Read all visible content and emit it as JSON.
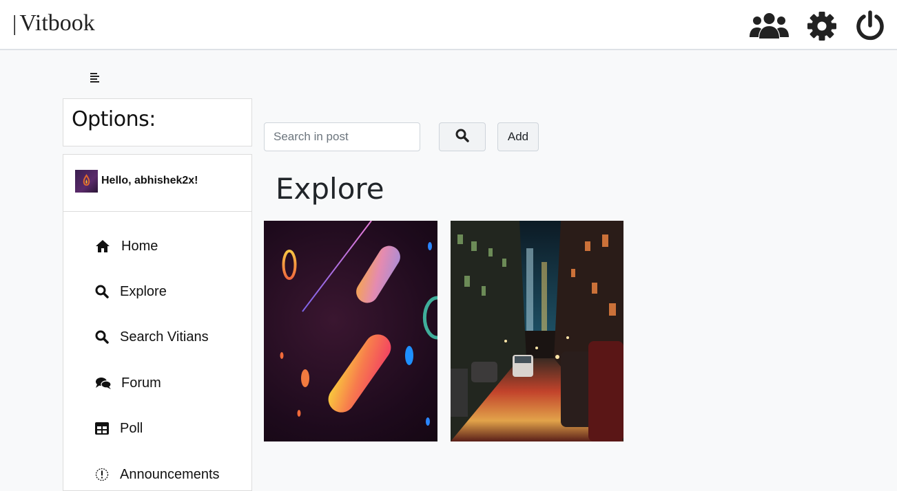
{
  "header": {
    "brand_bar": "|",
    "brand": "Vitbook",
    "icons": [
      "users-icon",
      "gear-icon",
      "power-icon"
    ]
  },
  "sidebar": {
    "options_title": "Options:",
    "greeting": "Hello, abhishek2x!",
    "items": [
      {
        "label": "Home",
        "icon": "home-icon"
      },
      {
        "label": "Explore",
        "icon": "search-icon"
      },
      {
        "label": "Search Vitians",
        "icon": "search-icon"
      },
      {
        "label": "Forum",
        "icon": "comments-icon"
      },
      {
        "label": "Poll",
        "icon": "table-icon"
      },
      {
        "label": "Announcements",
        "icon": "exclamation-circle-icon"
      }
    ]
  },
  "main": {
    "search_placeholder": "Search in post",
    "search_value": "",
    "add_label": "Add",
    "heading": "Explore",
    "posts": [
      "abstract-gradient-image",
      "night-city-street-image"
    ]
  },
  "colors": {
    "page_bg": "#f8f9fa",
    "topbar_bg": "#ffffff",
    "text": "#212529",
    "border": "#dcdcdc"
  }
}
